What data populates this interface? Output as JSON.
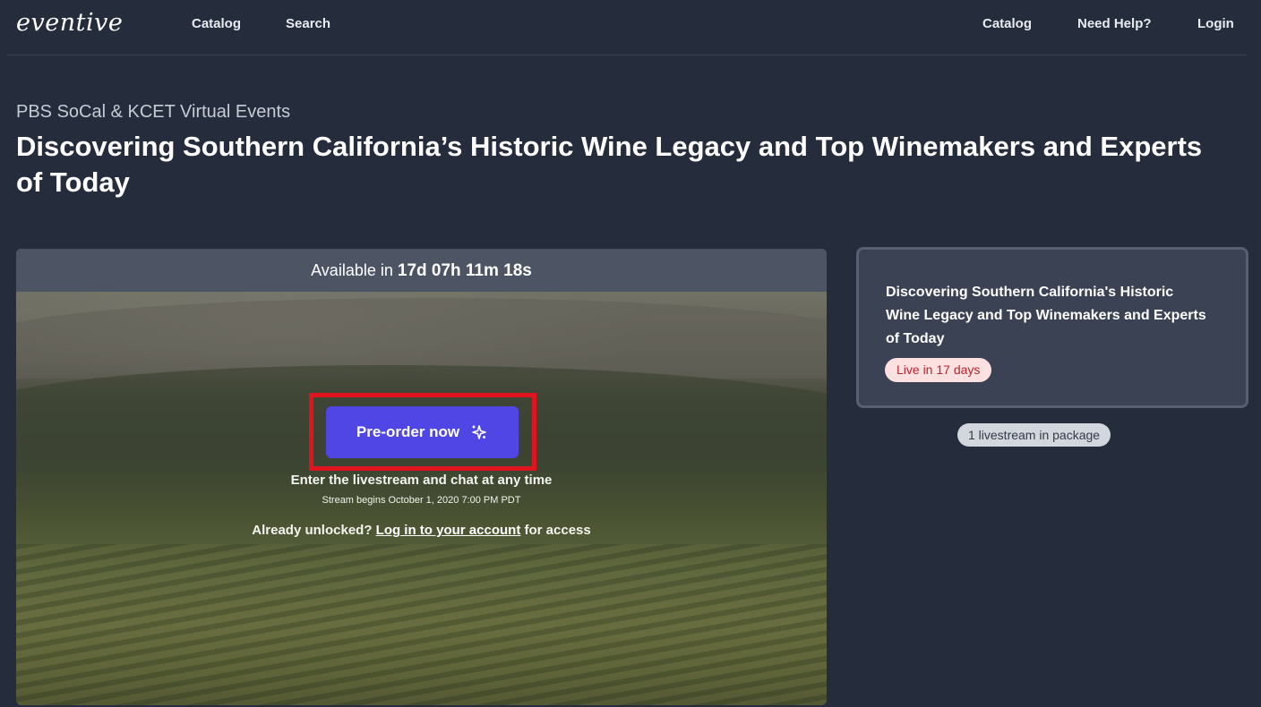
{
  "nav": {
    "logo": "eventive",
    "left": [
      "Catalog",
      "Search"
    ],
    "right": [
      "Catalog",
      "Need Help?",
      "Login"
    ]
  },
  "header": {
    "eyebrow": "PBS SoCal & KCET Virtual Events",
    "title": "Discovering Southern California’s Historic Wine Legacy and Top Winemakers and Experts of Today"
  },
  "player": {
    "available_prefix": "Available in",
    "countdown": "17d 07h 11m 18s",
    "preorder_label": "Pre-order now",
    "preorder_icon": "sparkle-icon",
    "enter_text": "Enter the livestream and chat at any time",
    "stream_text": "Stream begins October 1, 2020 7:00 PM PDT",
    "unlocked_prefix": "Already unlocked?",
    "login_link": "Log in to your account",
    "unlocked_suffix": "for access"
  },
  "side_card": {
    "title": "Discovering Southern California's Historic Wine Legacy and Top Winemakers and Experts of Today",
    "badge": "Live in 17 days"
  },
  "package_badge": "1 livestream in package",
  "colors": {
    "background": "#252c3b",
    "button": "#5046e5",
    "highlight": "#e0141e",
    "badge_bg": "#fde1e1",
    "badge_text": "#b3262e"
  }
}
